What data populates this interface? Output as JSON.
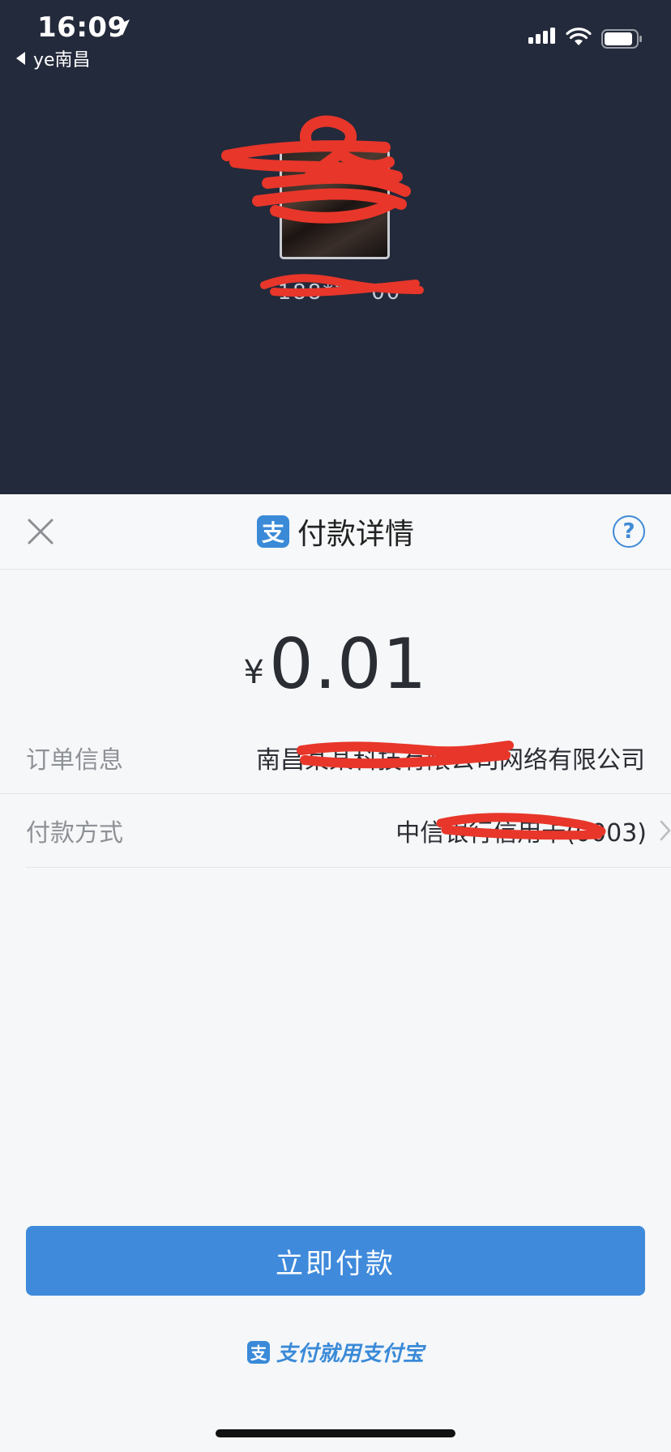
{
  "status_bar": {
    "time": "16:09",
    "back_label": "ye南昌"
  },
  "merchant": {
    "account_masked": "188****00"
  },
  "sheet": {
    "title": "付款详情",
    "logo_glyph": "支",
    "help_glyph": "?"
  },
  "amount": {
    "currency": "¥",
    "value": "0.01"
  },
  "rows": {
    "order_label": "订单信息",
    "order_value": "南昌某某科技有限公司网络有限公司",
    "method_label": "付款方式",
    "method_value": "中信银行信用卡(0003)"
  },
  "actions": {
    "pay_label": "立即付款"
  },
  "footer": {
    "slogan": "支付就用支付宝",
    "logo_glyph": "支"
  },
  "colors": {
    "accent": "#3f8adb",
    "header_bg": "#232a3b",
    "redaction": "#e8362a"
  }
}
